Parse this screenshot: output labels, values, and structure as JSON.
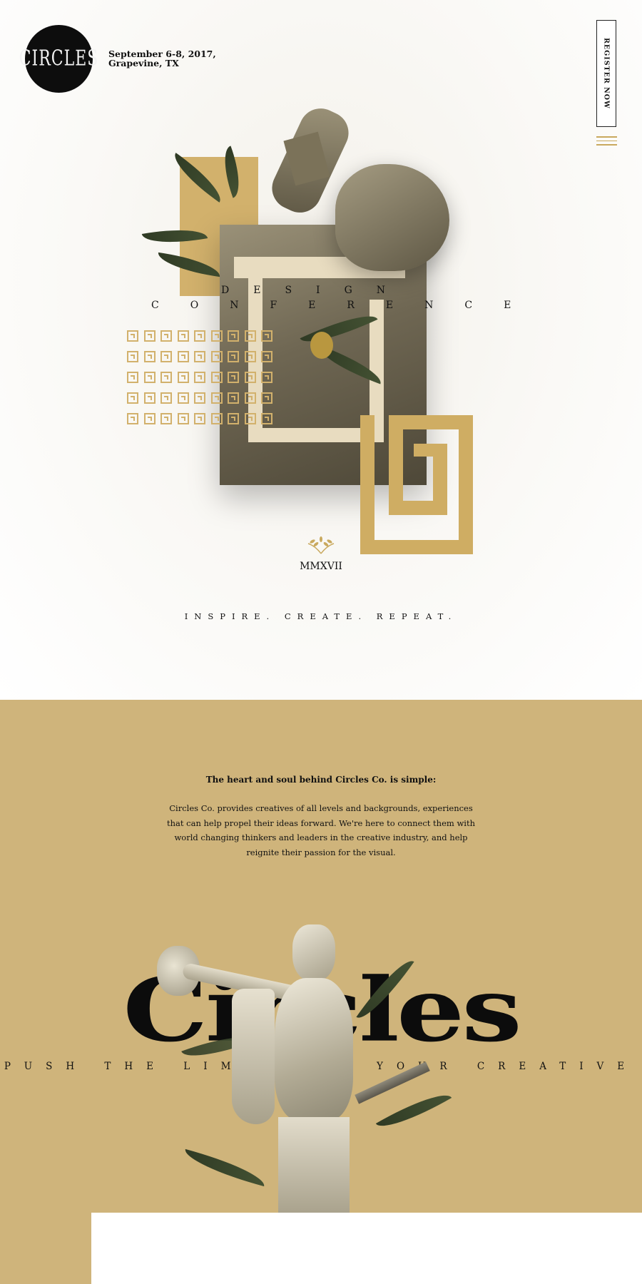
{
  "header": {
    "logo_text": "CIRCLES",
    "event_date_line1": "September 6-8, 2017,",
    "event_date_line2": "Grapevine, TX",
    "register_label": "REGISTER NOW",
    "menu_icon": "hamburger-icon"
  },
  "hero": {
    "word_design": "DESIGN",
    "word_conference": "CONFERENCE",
    "year": "MMXVII",
    "tagline": "INSPIRE. CREATE. REPEAT.",
    "pattern_icon": "greek-key-icon",
    "laurel_icon": "laurel-icon"
  },
  "about": {
    "heading": "The heart and soul behind Circles Co. is simple:",
    "body": "Circles Co. provides creatives of all levels and backgrounds, experiences that can help propel their ideas forward. We're here to connect them with world changing thinkers and leaders in the creative industry, and help reignite their passion for the visual.",
    "big_word": "Circles",
    "sub_line": "PUSH THE LIMITS OF YOUR CREATIVE"
  },
  "colors": {
    "gold": "#d2b16c",
    "section_bg": "#cfb47b",
    "ink": "#111111"
  }
}
